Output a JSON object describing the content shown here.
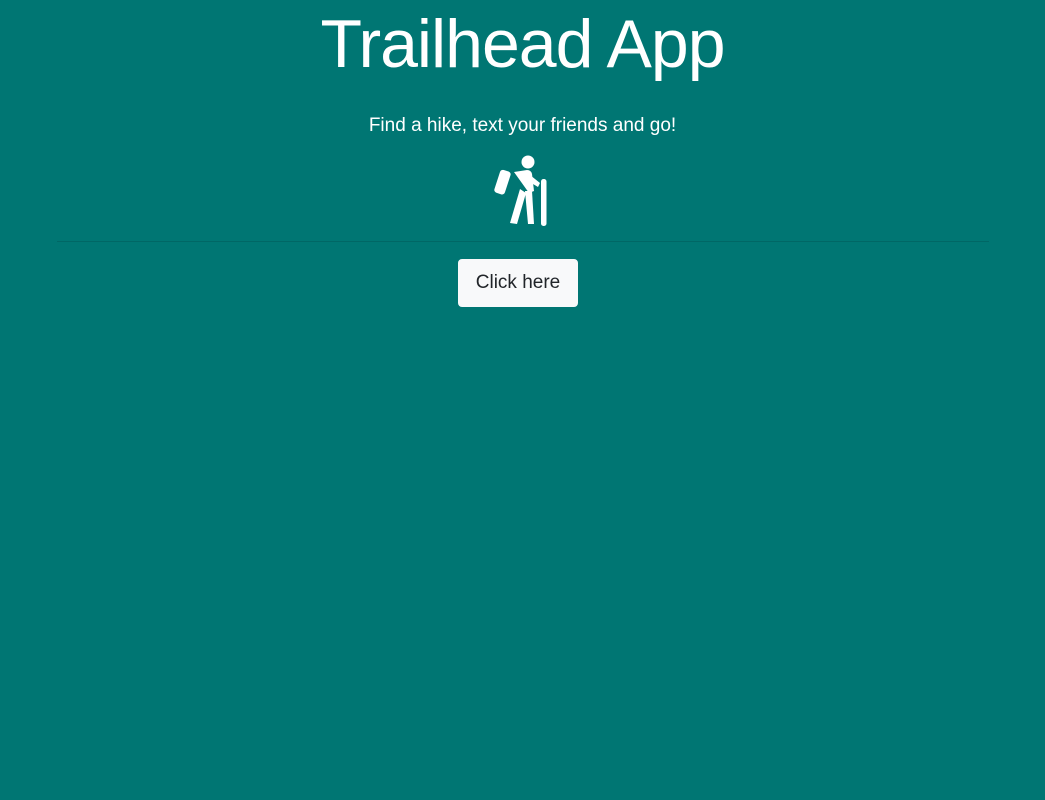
{
  "header": {
    "title": "Trailhead App",
    "tagline": "Find a hike, text your friends and go!",
    "icon": "hiking-icon"
  },
  "cta": {
    "label": "Click here"
  },
  "colors": {
    "background": "#007673",
    "text": "#ffffff",
    "button_background": "#f8f9fa",
    "button_text": "#212529"
  }
}
